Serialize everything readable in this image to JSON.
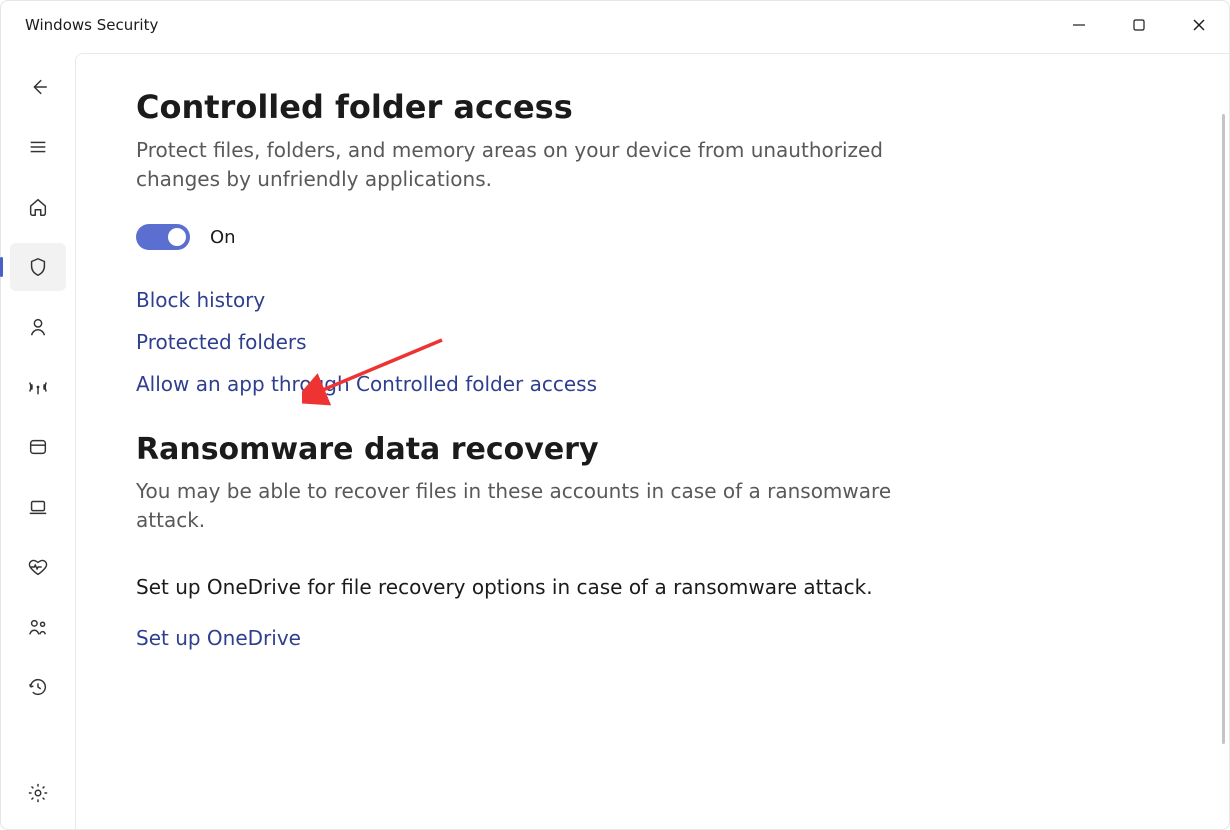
{
  "window": {
    "title": "Windows Security"
  },
  "page": {
    "heading": "Controlled folder access",
    "description": "Protect files, folders, and memory areas on your device from unauthorized changes by unfriendly applications.",
    "toggle": {
      "state_label": "On"
    },
    "links": {
      "block_history": "Block history",
      "protected_folders": "Protected folders",
      "allow_app": "Allow an app through Controlled folder access"
    },
    "recovery": {
      "heading": "Ransomware data recovery",
      "description": "You may be able to recover files in these accounts in case of a ransomware attack.",
      "onedrive_prompt": "Set up OneDrive for file recovery options in case of a ransomware attack.",
      "onedrive_link": "Set up OneDrive"
    }
  }
}
